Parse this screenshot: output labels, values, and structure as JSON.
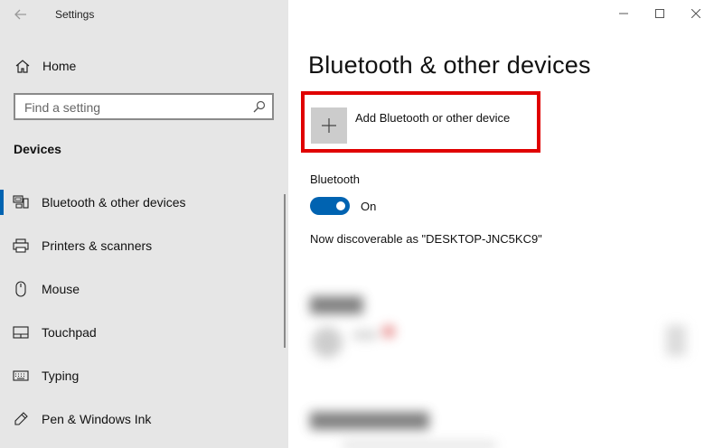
{
  "window": {
    "app_title": "Settings"
  },
  "sidebar": {
    "home_label": "Home",
    "search_placeholder": "Find a setting",
    "section_heading": "Devices",
    "items": [
      {
        "label": "Bluetooth & other devices",
        "icon": "bluetooth-devices-icon",
        "selected": true
      },
      {
        "label": "Printers & scanners",
        "icon": "printer-icon",
        "selected": false
      },
      {
        "label": "Mouse",
        "icon": "mouse-icon",
        "selected": false
      },
      {
        "label": "Touchpad",
        "icon": "touchpad-icon",
        "selected": false
      },
      {
        "label": "Typing",
        "icon": "keyboard-icon",
        "selected": false
      },
      {
        "label": "Pen & Windows Ink",
        "icon": "pen-icon",
        "selected": false
      }
    ]
  },
  "main": {
    "page_title": "Bluetooth & other devices",
    "add_device_label": "Add Bluetooth or other device",
    "bluetooth_label": "Bluetooth",
    "toggle_state": "On",
    "toggle_on": true,
    "discoverable_text": "Now discoverable as \"DESKTOP-JNC5KC9\""
  },
  "colors": {
    "accent": "#0063b1",
    "highlight_box": "#e00000",
    "sidebar_bg": "#e6e6e6"
  }
}
